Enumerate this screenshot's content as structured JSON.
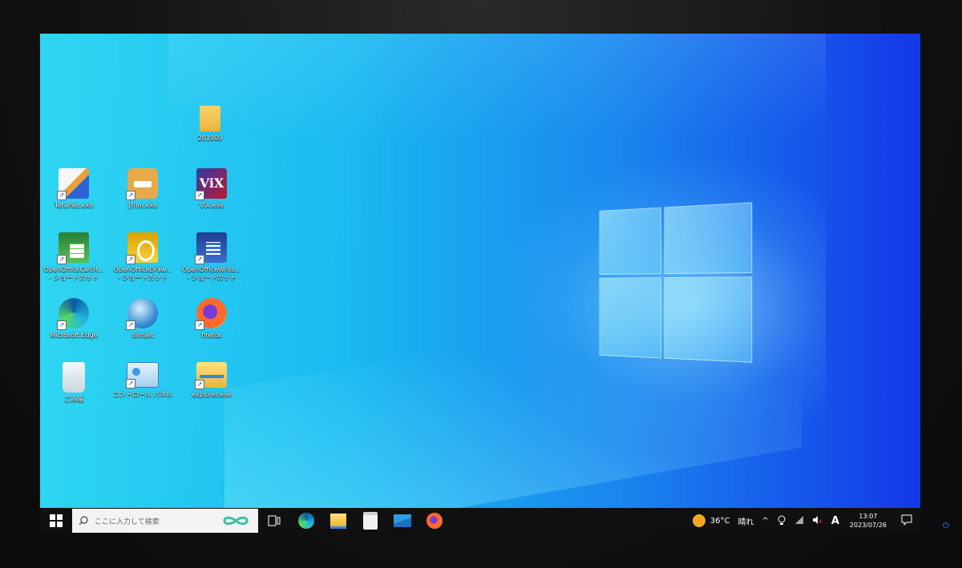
{
  "desktop": {
    "icons": [
      {
        "label": "201909"
      },
      {
        "label": "TeraPad.exe"
      },
      {
        "label": "JTrim.exe"
      },
      {
        "label": "ViX.exe"
      },
      {
        "label": "OpenOfficeCalcR..."
      },
      {
        "label": "- ショートカット"
      },
      {
        "label": "OpenOfficeDraw..."
      },
      {
        "label": "- ショートカット"
      },
      {
        "label": "OpenOfficeWrite..."
      },
      {
        "label": "- ショートカット"
      },
      {
        "label": "Microsoft Edge"
      },
      {
        "label": "slimjet"
      },
      {
        "label": "firefox"
      },
      {
        "label": "ごみ箱"
      },
      {
        "label": "コントロール パネル"
      },
      {
        "label": "explorer.exe"
      }
    ],
    "vix_text": "ViX"
  },
  "taskbar": {
    "search_placeholder": "ここに入力して検索",
    "weather_temp": "36°C",
    "weather_text": "晴れ",
    "ime": "A",
    "time": "13:07",
    "date": "2023/07/26"
  },
  "colors": {
    "accent": "#1a88ee",
    "taskbar": "#101010"
  }
}
